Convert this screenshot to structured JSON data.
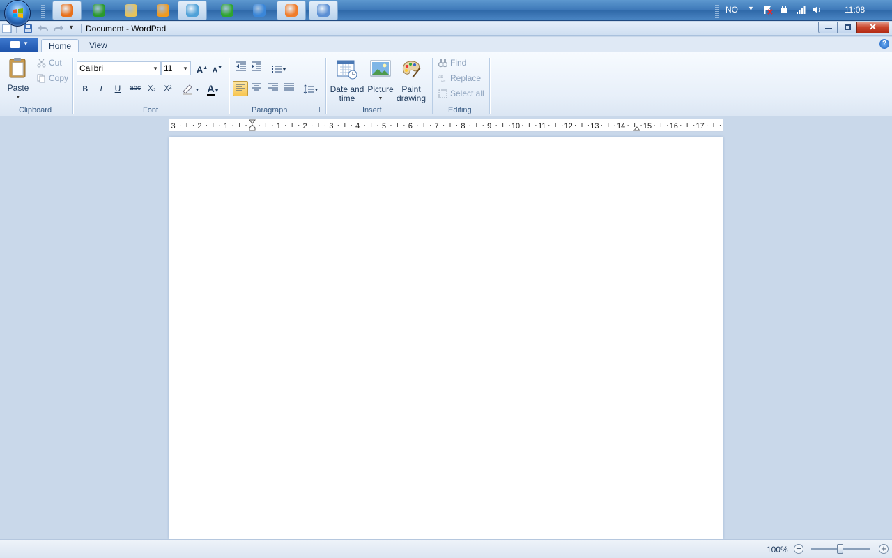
{
  "window": {
    "title": "Document - WordPad"
  },
  "taskbar": {
    "language": "NO",
    "clock": "11:08",
    "pinned": [
      {
        "name": "firefox-icon",
        "color": "#e8701a"
      },
      {
        "name": "spotify-icon",
        "color": "#2b9a2b"
      },
      {
        "name": "explorer-folder-icon",
        "color": "#e7c35a"
      },
      {
        "name": "media-player-icon",
        "color": "#f09a1d"
      },
      {
        "name": "contacts-icon",
        "color": "#4fa1d8"
      },
      {
        "name": "wireless-icon",
        "color": "#2fa52f"
      },
      {
        "name": "sync-icon",
        "color": "#3a86d8"
      },
      {
        "name": "xampp-icon",
        "color": "#f07c2a"
      },
      {
        "name": "wordpad-icon",
        "color": "#5b8fd4"
      }
    ]
  },
  "ribbon": {
    "tabs": [
      "Home",
      "View"
    ],
    "selected_tab": "Home",
    "clipboard": {
      "label": "Clipboard",
      "paste": "Paste",
      "cut": "Cut",
      "copy": "Copy"
    },
    "font": {
      "label": "Font",
      "family": "Calibri",
      "size": "11",
      "bold": "B",
      "italic": "I",
      "underline": "U",
      "strikethrough": "abc",
      "subscript": "X₂",
      "superscript": "X²",
      "font_color": "A"
    },
    "paragraph": {
      "label": "Paragraph"
    },
    "insert": {
      "label": "Insert",
      "date_time_1": "Date and",
      "date_time_2": "time",
      "picture": "Picture",
      "paint_1": "Paint",
      "paint_2": "drawing"
    },
    "editing": {
      "label": "Editing",
      "find": "Find",
      "replace": "Replace",
      "select_all": "Select all"
    }
  },
  "ruler": {
    "labels": [
      "3",
      "2",
      "1",
      "1",
      "2",
      "3",
      "4",
      "5",
      "6",
      "7",
      "8",
      "9",
      "10",
      "11",
      "12",
      "13",
      "14",
      "15",
      "16",
      "17"
    ]
  },
  "statusbar": {
    "zoom": "100%",
    "zoom_out": "−",
    "zoom_in": "+"
  },
  "help": "?"
}
